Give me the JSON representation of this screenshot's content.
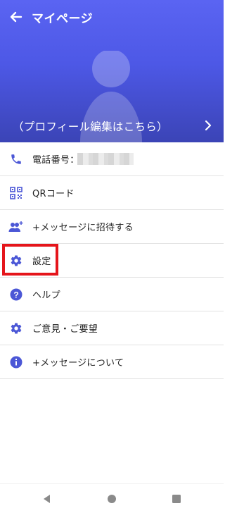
{
  "header": {
    "title": "マイページ",
    "profile_link": "（プロフィール編集はこちら）",
    "colors": {
      "top": "#5a64f2",
      "bottom": "#3b44b6"
    }
  },
  "menu": [
    {
      "label": "電話番号：",
      "icon": "phone-icon"
    },
    {
      "label": "QRコード",
      "icon": "qr-code-icon"
    },
    {
      "label": "+メッセージに招待する",
      "icon": "invite-people-icon"
    },
    {
      "label": "設定",
      "icon": "gear-icon"
    },
    {
      "label": "ヘルプ",
      "icon": "help-icon"
    },
    {
      "label": "ご意見・ご要望",
      "icon": "gear-icon"
    },
    {
      "label": "+メッセージについて",
      "icon": "info-icon"
    }
  ],
  "accent_color": "#4b57d6",
  "highlight_color": "#e5151b",
  "system_nav": [
    "back-icon",
    "home-icon",
    "recents-icon"
  ]
}
